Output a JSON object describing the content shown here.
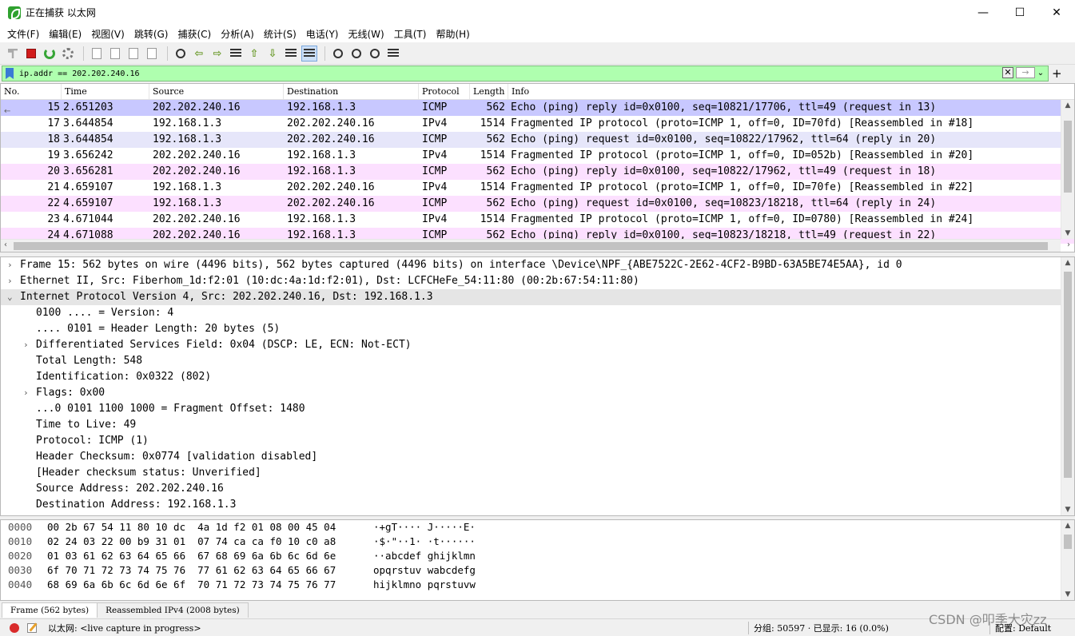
{
  "window": {
    "title": "正在捕获 以太网",
    "controls": {
      "minimize": "—",
      "maximize": "☐",
      "close": "✕"
    }
  },
  "menu": [
    "文件(F)",
    "编辑(E)",
    "视图(V)",
    "跳转(G)",
    "捕获(C)",
    "分析(A)",
    "统计(S)",
    "电话(Y)",
    "无线(W)",
    "工具(T)",
    "帮助(H)"
  ],
  "toolbar": {
    "icons": [
      "start-capture-icon",
      "stop-capture-icon",
      "restart-capture-icon",
      "capture-options-icon",
      "open-file-icon",
      "save-file-icon",
      "close-file-icon",
      "reload-file-icon",
      "find-packet-icon",
      "go-back-icon",
      "go-forward-icon",
      "go-to-packet-icon",
      "go-first-icon",
      "go-last-icon",
      "auto-scroll-icon",
      "colorize-icon",
      "zoom-in-icon",
      "zoom-out-icon",
      "normal-size-icon",
      "resize-columns-icon"
    ]
  },
  "filter": {
    "value": "ip.addr == 202.202.240.16",
    "clear_glyph": "✕",
    "apply_glyph": "→",
    "dropdown_glyph": "⌄",
    "add_glyph": "+"
  },
  "packet_list": {
    "columns": [
      "No.",
      "Time",
      "Source",
      "Destination",
      "Protocol",
      "Length",
      "Info"
    ],
    "rows": [
      {
        "no": "15",
        "time": "2.651203",
        "src": "202.202.240.16",
        "dst": "192.168.1.3",
        "proto": "ICMP",
        "len": "562",
        "info": "Echo (ping) reply    id=0x0100, seq=10821/17706, ttl=49 (request in 13)",
        "kind": "selected"
      },
      {
        "no": "17",
        "time": "3.644854",
        "src": "192.168.1.3",
        "dst": "202.202.240.16",
        "proto": "IPv4",
        "len": "1514",
        "info": "Fragmented IP protocol (proto=ICMP 1, off=0, ID=70fd) [Reassembled in #18]",
        "kind": "ipv4"
      },
      {
        "no": "18",
        "time": "3.644854",
        "src": "192.168.1.3",
        "dst": "202.202.240.16",
        "proto": "ICMP",
        "len": "562",
        "info": "Echo (ping) request  id=0x0100, seq=10822/17962, ttl=64 (reply in 20)",
        "kind": "icmp-alt"
      },
      {
        "no": "19",
        "time": "3.656242",
        "src": "202.202.240.16",
        "dst": "192.168.1.3",
        "proto": "IPv4",
        "len": "1514",
        "info": "Fragmented IP protocol (proto=ICMP 1, off=0, ID=052b) [Reassembled in #20]",
        "kind": "ipv4"
      },
      {
        "no": "20",
        "time": "3.656281",
        "src": "202.202.240.16",
        "dst": "192.168.1.3",
        "proto": "ICMP",
        "len": "562",
        "info": "Echo (ping) reply    id=0x0100, seq=10822/17962, ttl=49 (request in 18)",
        "kind": "icmp"
      },
      {
        "no": "21",
        "time": "4.659107",
        "src": "192.168.1.3",
        "dst": "202.202.240.16",
        "proto": "IPv4",
        "len": "1514",
        "info": "Fragmented IP protocol (proto=ICMP 1, off=0, ID=70fe) [Reassembled in #22]",
        "kind": "ipv4"
      },
      {
        "no": "22",
        "time": "4.659107",
        "src": "192.168.1.3",
        "dst": "202.202.240.16",
        "proto": "ICMP",
        "len": "562",
        "info": "Echo (ping) request  id=0x0100, seq=10823/18218, ttl=64 (reply in 24)",
        "kind": "icmp"
      },
      {
        "no": "23",
        "time": "4.671044",
        "src": "202.202.240.16",
        "dst": "192.168.1.3",
        "proto": "IPv4",
        "len": "1514",
        "info": "Fragmented IP protocol (proto=ICMP 1, off=0, ID=0780) [Reassembled in #24]",
        "kind": "ipv4"
      },
      {
        "no": "24",
        "time": "4.671088",
        "src": "202.202.240.16",
        "dst": "192.168.1.3",
        "proto": "ICMP",
        "len": "562",
        "info": "Echo (ping) reply    id=0x0100, seq=10823/18218, ttl=49 (request in 22)",
        "kind": "icmp"
      }
    ],
    "related_mark": "←"
  },
  "details": {
    "rows": [
      {
        "text": "Frame 15: 562 bytes on wire (4496 bits), 562 bytes captured (4496 bits) on interface \\Device\\NPF_{ABE7522C-2E62-4CF2-B9BD-63A5BE74E5AA}, id 0",
        "level": 0,
        "twisty": "›"
      },
      {
        "text": "Ethernet II, Src: Fiberhom_1d:f2:01 (10:dc:4a:1d:f2:01), Dst: LCFCHeFe_54:11:80 (00:2b:67:54:11:80)",
        "level": 0,
        "twisty": "›"
      },
      {
        "text": "Internet Protocol Version 4, Src: 202.202.240.16, Dst: 192.168.1.3",
        "level": 0,
        "twisty": "⌄",
        "highlight": true
      },
      {
        "text": "0100 .... = Version: 4",
        "level": 1,
        "twisty": ""
      },
      {
        "text": ".... 0101 = Header Length: 20 bytes (5)",
        "level": 1,
        "twisty": ""
      },
      {
        "text": "Differentiated Services Field: 0x04 (DSCP: LE, ECN: Not-ECT)",
        "level": 1,
        "twisty": "›"
      },
      {
        "text": "Total Length: 548",
        "level": 1,
        "twisty": ""
      },
      {
        "text": "Identification: 0x0322 (802)",
        "level": 1,
        "twisty": ""
      },
      {
        "text": "Flags: 0x00",
        "level": 1,
        "twisty": "›"
      },
      {
        "text": "...0 0101 1100 1000 = Fragment Offset: 1480",
        "level": 1,
        "twisty": ""
      },
      {
        "text": "Time to Live: 49",
        "level": 1,
        "twisty": ""
      },
      {
        "text": "Protocol: ICMP (1)",
        "level": 1,
        "twisty": ""
      },
      {
        "text": "Header Checksum: 0x0774 [validation disabled]",
        "level": 1,
        "twisty": ""
      },
      {
        "text": "[Header checksum status: Unverified]",
        "level": 1,
        "twisty": ""
      },
      {
        "text": "Source Address: 202.202.240.16",
        "level": 1,
        "twisty": ""
      },
      {
        "text": "Destination Address: 192.168.1.3",
        "level": 1,
        "twisty": ""
      }
    ]
  },
  "bytes": {
    "rows": [
      {
        "offset": "0000",
        "hex": "00 2b 67 54 11 80 10 dc  4a 1d f2 01 08 00 45 04",
        "ascii": "·+gT···· J·····E·"
      },
      {
        "offset": "0010",
        "hex": "02 24 03 22 00 b9 31 01  07 74 ca ca f0 10 c0 a8",
        "ascii": "·$·\"··1· ·t······"
      },
      {
        "offset": "0020",
        "hex": "01 03 61 62 63 64 65 66  67 68 69 6a 6b 6c 6d 6e",
        "ascii": "··abcdef ghijklmn"
      },
      {
        "offset": "0030",
        "hex": "6f 70 71 72 73 74 75 76  77 61 62 63 64 65 66 67",
        "ascii": "opqrstuv wabcdefg"
      },
      {
        "offset": "0040",
        "hex": "68 69 6a 6b 6c 6d 6e 6f  70 71 72 73 74 75 76 77",
        "ascii": "hijklmno pqrstuvw"
      }
    ]
  },
  "byte_tabs": [
    "Frame (562 bytes)",
    "Reassembled IPv4 (2008 bytes)"
  ],
  "status": {
    "interface": "以太网: <live capture in progress>",
    "packets": "分组: 50597 · 已显示: 16 (0.0%)",
    "profile": "配置: Default"
  },
  "watermark": "CSDN @叩季大灾zz",
  "colors": {
    "filter_valid": "#afffaf",
    "row_selected": "#c8c8ff",
    "row_icmp": "#fce0ff",
    "row_icmp_alt": "#e6e6fa",
    "record": "#d92b2b"
  }
}
